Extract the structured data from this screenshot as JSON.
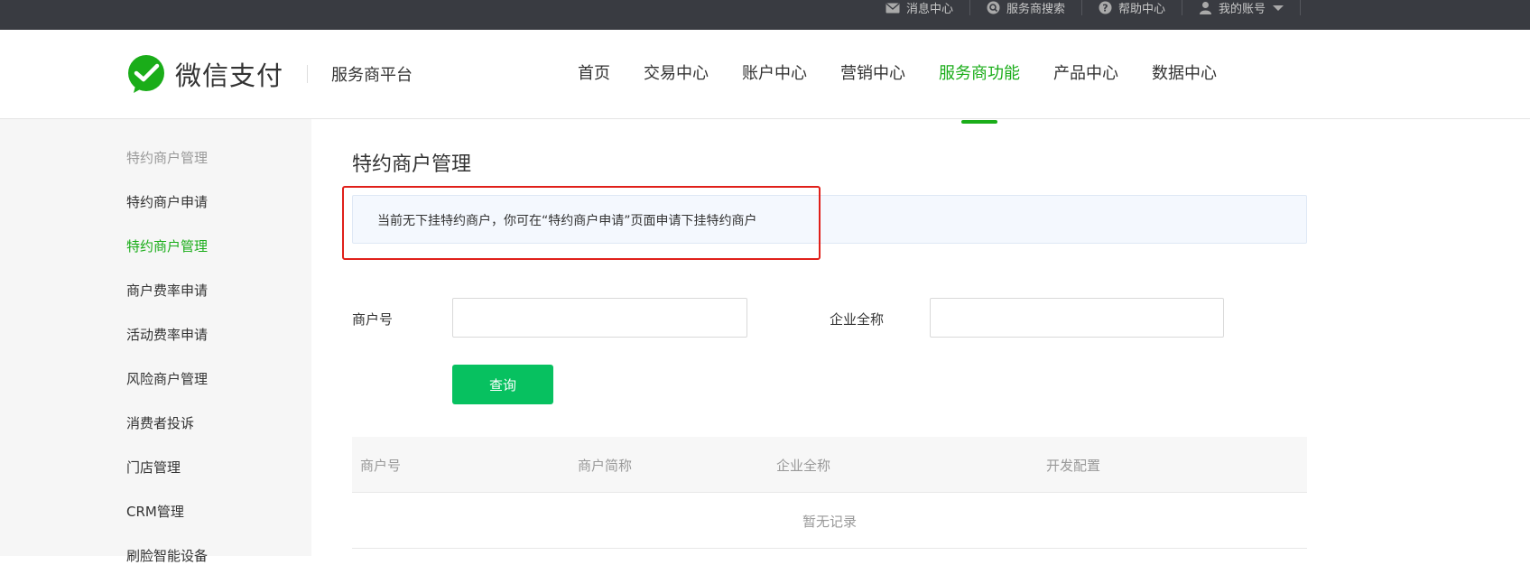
{
  "topbar": {
    "links": [
      {
        "label": "消息中心",
        "icon": "mail-icon"
      },
      {
        "label": "服务商搜索",
        "icon": "search-icon"
      },
      {
        "label": "帮助中心",
        "icon": "help-icon"
      },
      {
        "label": "我的账号",
        "icon": "user-icon"
      }
    ]
  },
  "header": {
    "brand": "微信支付",
    "platform": "服务商平台",
    "nav": [
      {
        "label": "首页"
      },
      {
        "label": "交易中心"
      },
      {
        "label": "账户中心"
      },
      {
        "label": "营销中心"
      },
      {
        "label": "服务商功能",
        "active": true
      },
      {
        "label": "产品中心"
      },
      {
        "label": "数据中心"
      }
    ]
  },
  "sidebar": {
    "group_label": "特约商户管理",
    "items": [
      {
        "label": "特约商户申请"
      },
      {
        "label": "特约商户管理",
        "active": true
      },
      {
        "label": "商户费率申请"
      },
      {
        "label": "活动费率申请"
      },
      {
        "label": "风险商户管理"
      },
      {
        "label": "消费者投诉"
      },
      {
        "label": "门店管理"
      },
      {
        "label": "CRM管理"
      },
      {
        "label": "刷脸智能设备"
      }
    ]
  },
  "main": {
    "title": "特约商户管理",
    "notice": "当前无下挂特约商户，你可在“特约商户申请”页面申请下挂特约商户",
    "form": {
      "merchant_id_label": "商户号",
      "merchant_id_value": "",
      "company_label": "企业全称",
      "company_value": "",
      "query_button": "查询"
    },
    "table": {
      "columns": [
        "商户号",
        "商户简称",
        "企业全称",
        "开发配置"
      ],
      "empty_text": "暂无记录"
    }
  },
  "colors": {
    "accent": "#1aad19",
    "button": "#07c160",
    "topbar": "#393b41",
    "highlight": "#e0201a"
  }
}
